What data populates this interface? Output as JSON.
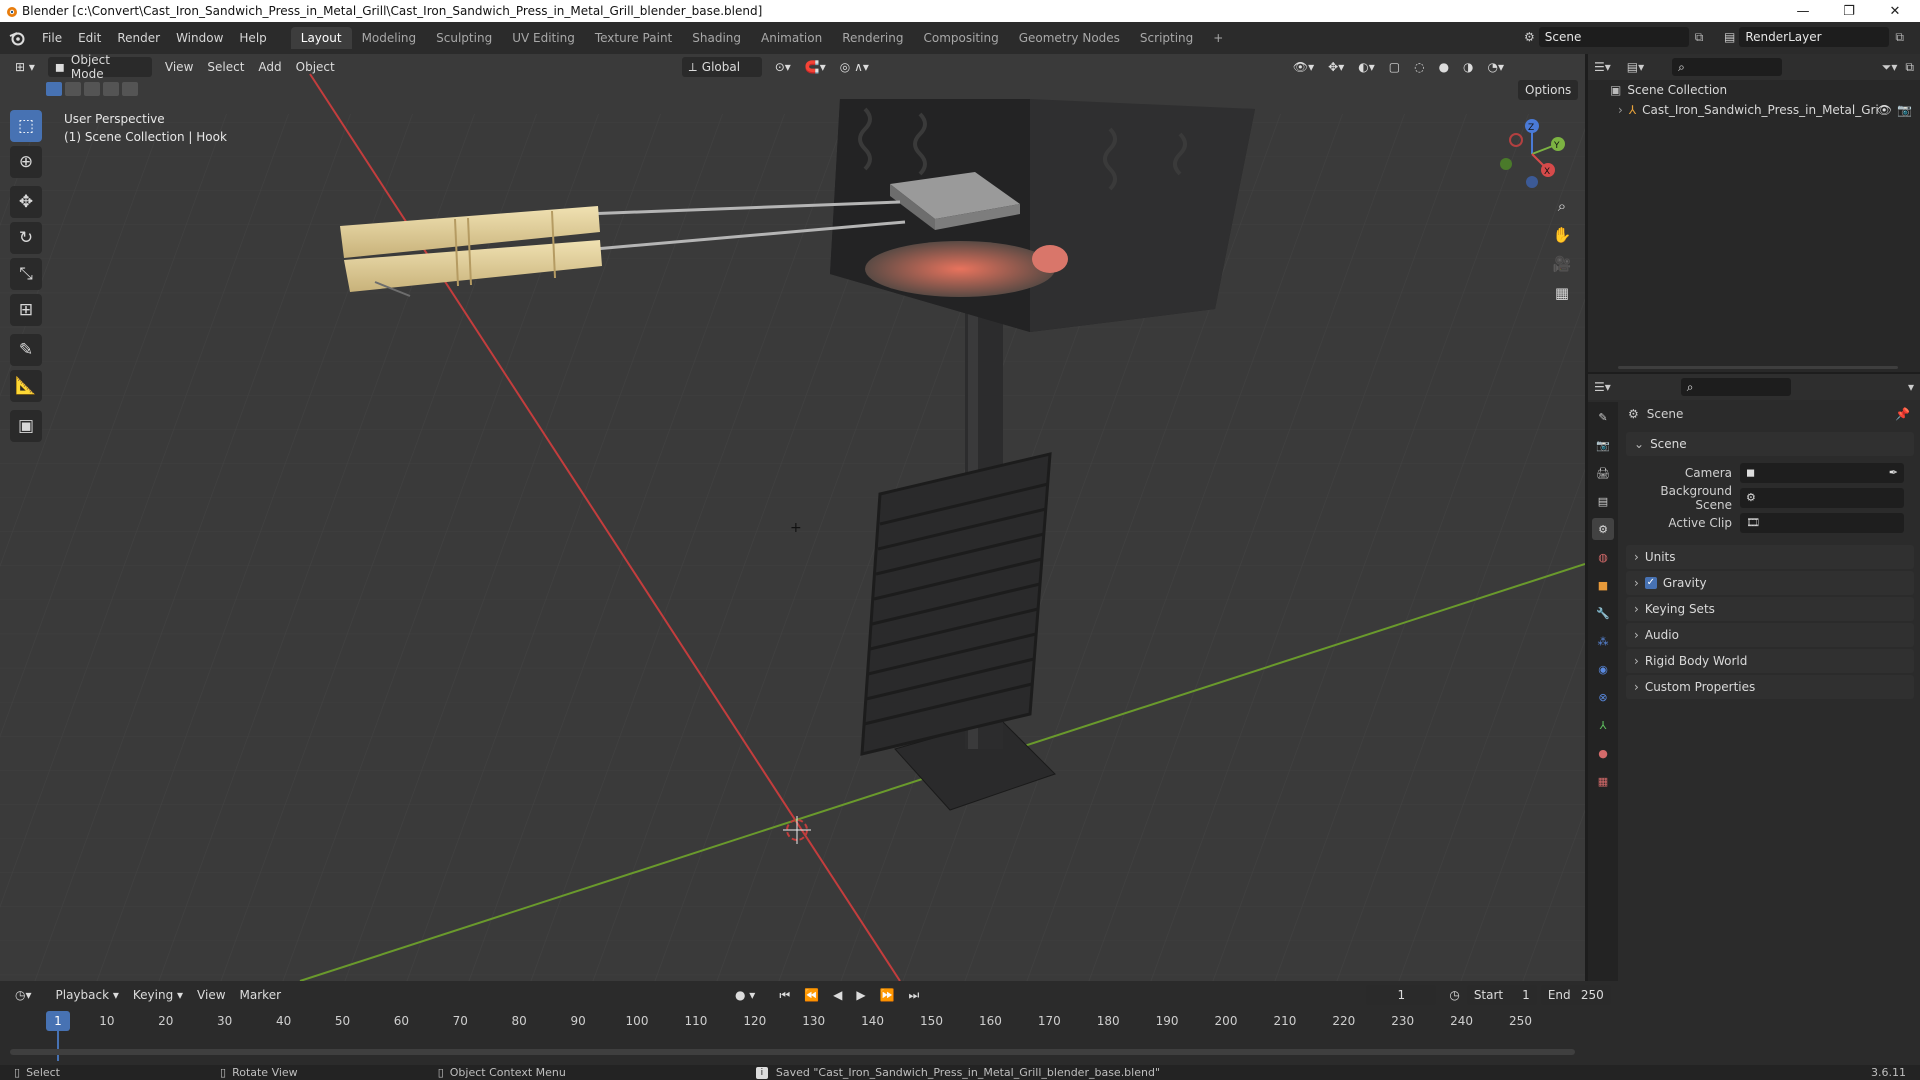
{
  "title_bar": {
    "title": "Blender [c:\\Convert\\Cast_Iron_Sandwich_Press_in_Metal_Grill\\Cast_Iron_Sandwich_Press_in_Metal_Grill_blender_base.blend]",
    "controls": [
      "—",
      "❐",
      "✕"
    ]
  },
  "menu": {
    "items": [
      "File",
      "Edit",
      "Render",
      "Window",
      "Help"
    ]
  },
  "workspaces": {
    "tabs": [
      "Layout",
      "Modeling",
      "Sculpting",
      "UV Editing",
      "Texture Paint",
      "Shading",
      "Animation",
      "Rendering",
      "Compositing",
      "Geometry Nodes",
      "Scripting"
    ],
    "active": "Layout",
    "add": "+"
  },
  "scene_selector": {
    "value": "Scene"
  },
  "view_layer": {
    "value": "RenderLayer"
  },
  "viewport_header": {
    "mode": "Object Mode",
    "menus": [
      "View",
      "Select",
      "Add",
      "Object"
    ],
    "transform_orientation": "Global",
    "options": "Options"
  },
  "viewport": {
    "perspective": "User Perspective",
    "context": "(1) Scene Collection | Hook",
    "accent_x": "#c33d3d",
    "accent_y": "#6a9a2c",
    "gizmo": {
      "x": "X",
      "y": "Y",
      "z": "Z"
    }
  },
  "outliner": {
    "root": "Scene Collection",
    "items": [
      {
        "name": "Cast_Iron_Sandwich_Press_in_Metal_Gri"
      }
    ]
  },
  "properties": {
    "context_label": "Scene",
    "panel_title": "Scene",
    "fields": {
      "camera": "Camera",
      "background_scene": "Background Scene",
      "active_clip": "Active Clip"
    },
    "collapsed_panels": [
      {
        "label": "Units",
        "checkbox": false
      },
      {
        "label": "Gravity",
        "checkbox": true
      },
      {
        "label": "Keying Sets",
        "checkbox": false
      },
      {
        "label": "Audio",
        "checkbox": false
      },
      {
        "label": "Rigid Body World",
        "checkbox": false
      },
      {
        "label": "Custom Properties",
        "checkbox": false
      }
    ]
  },
  "timeline": {
    "menus": [
      "Playback",
      "Keying",
      "View",
      "Marker"
    ],
    "current_frame": "1",
    "start_label": "Start",
    "start": "1",
    "end_label": "End",
    "end": "250",
    "ticks": [
      "10",
      "20",
      "30",
      "40",
      "50",
      "60",
      "70",
      "80",
      "90",
      "100",
      "110",
      "120",
      "130",
      "140",
      "150",
      "160",
      "170",
      "180",
      "190",
      "200",
      "210",
      "220",
      "230",
      "240",
      "250"
    ],
    "playhead": "1"
  },
  "status_bar": {
    "select": "Select",
    "rotate": "Rotate View",
    "context_menu": "Object Context Menu",
    "message": "Saved \"Cast_Iron_Sandwich_Press_in_Metal_Grill_blender_base.blend\"",
    "version": "3.6.11"
  }
}
